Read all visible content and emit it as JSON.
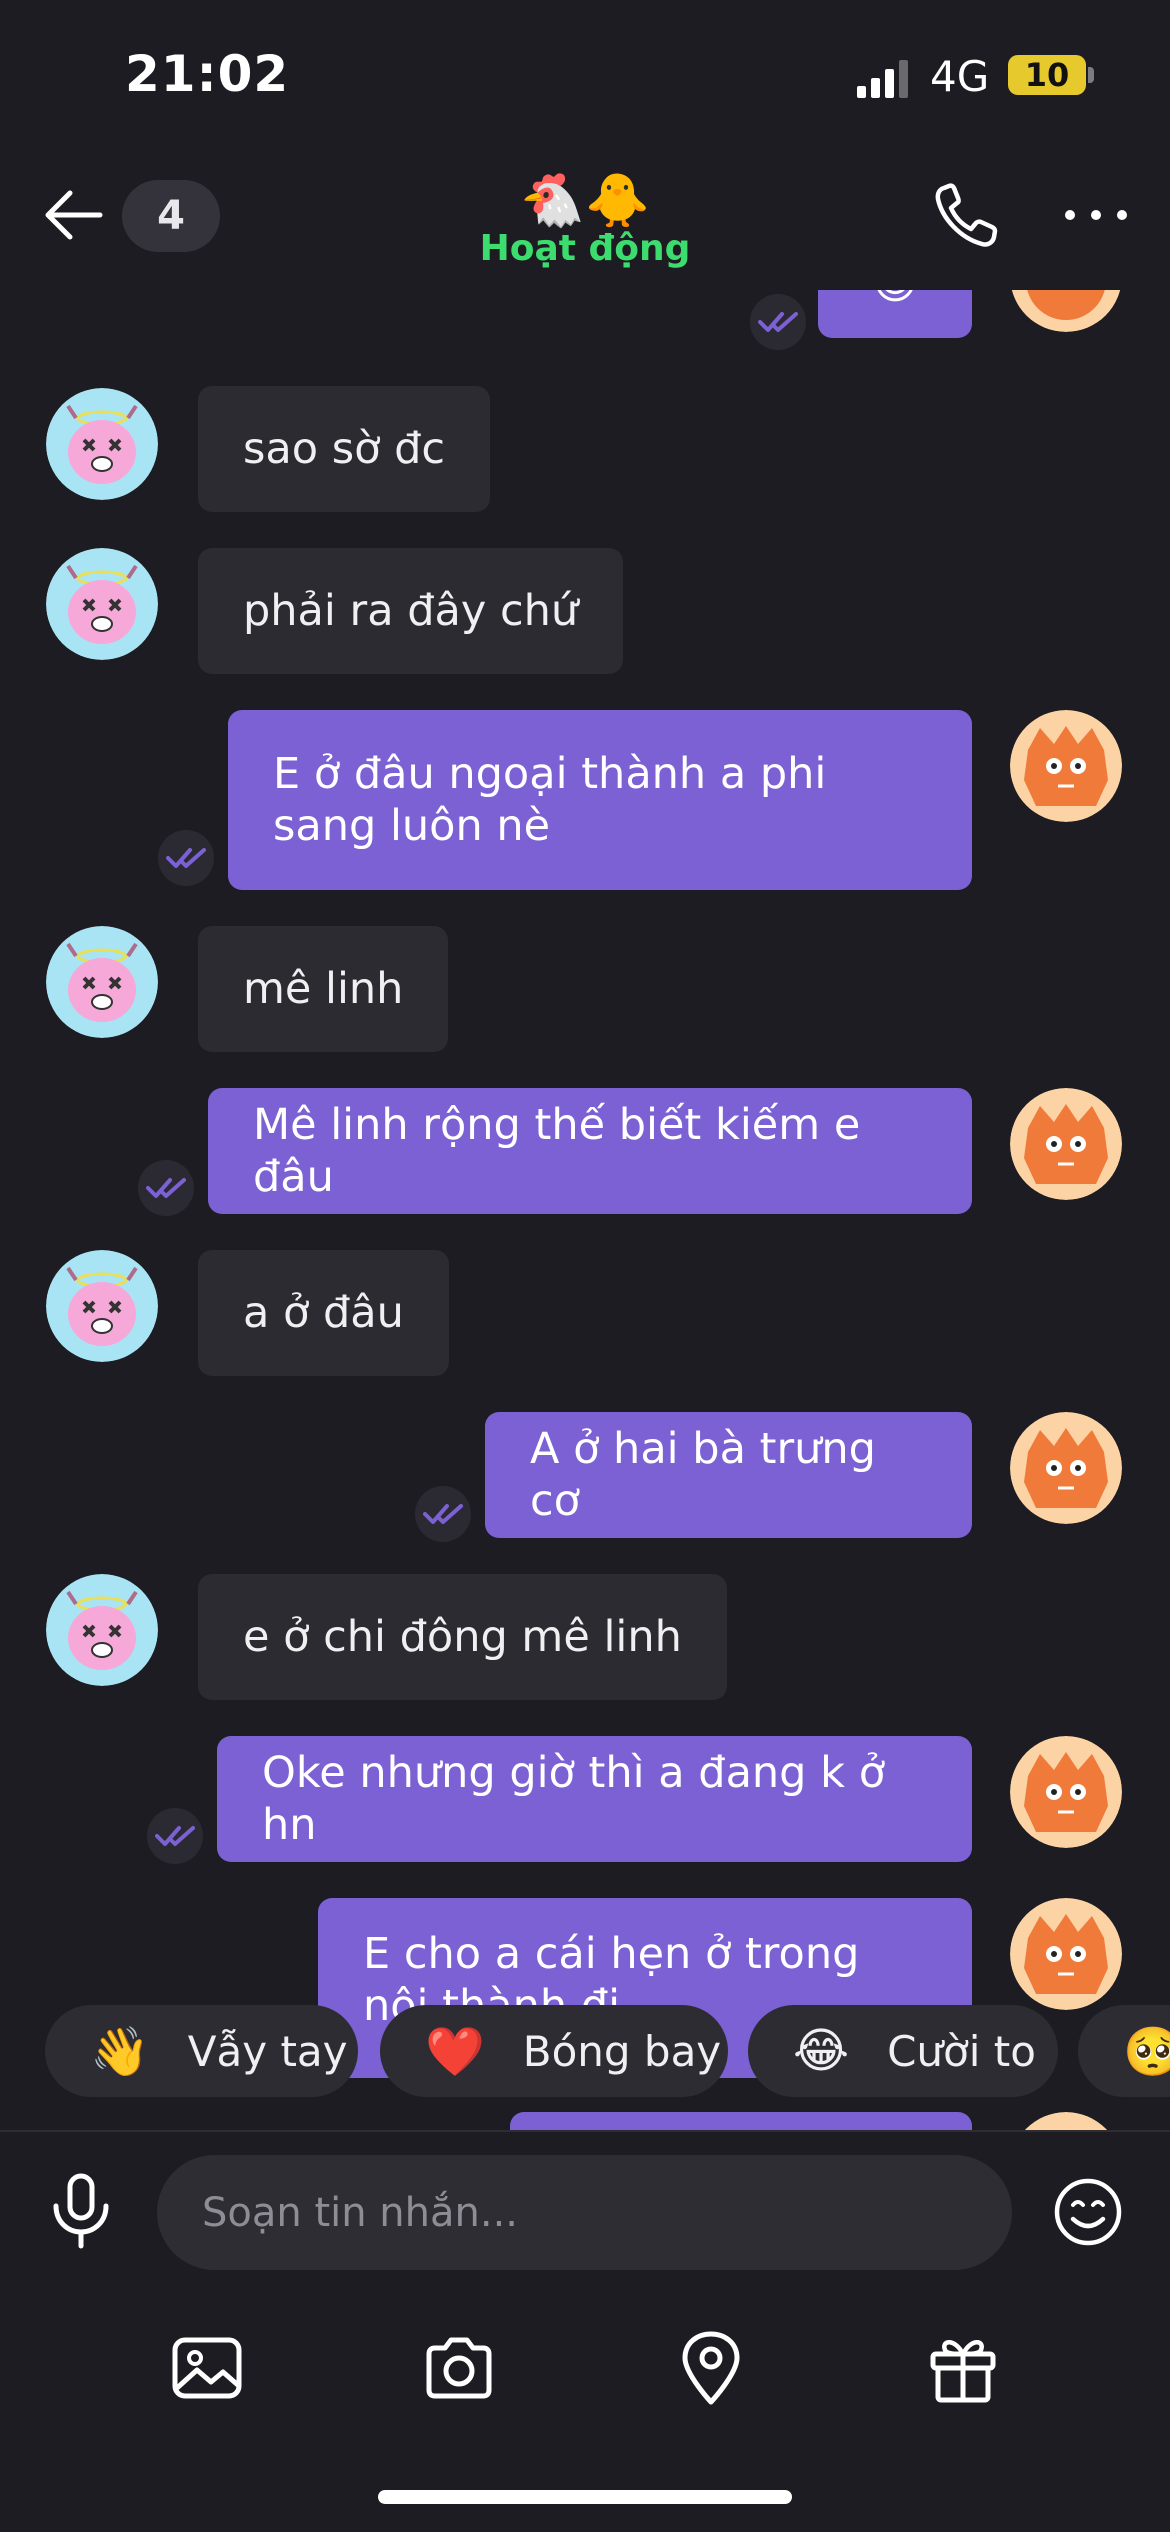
{
  "status_bar": {
    "time": "21:02",
    "network": "4G",
    "battery": "10"
  },
  "header": {
    "unread_count": "4",
    "emojis": "🐔🐥",
    "status": "Hoạt động"
  },
  "messages": [
    {
      "side": "in",
      "text": "sao sờ đc"
    },
    {
      "side": "in",
      "text": "phải ra đây chứ"
    },
    {
      "side": "out",
      "text": "E ở đâu ngoại thành a phi sang luôn nè"
    },
    {
      "side": "in",
      "text": "mê linh"
    },
    {
      "side": "out",
      "text": "Mê linh rộng thế biết kiếm e đâu"
    },
    {
      "side": "in",
      "text": "a ở đâu"
    },
    {
      "side": "out",
      "text": "A ở hai bà trưng cơ"
    },
    {
      "side": "in",
      "text": "e ở chi đông mê linh"
    },
    {
      "side": "out",
      "text": "Oke nhưng giờ thì a đang k ở hn"
    },
    {
      "side": "out",
      "text": "E cho a cái hẹn ở trong nội thành đi"
    }
  ],
  "quick_reactions": [
    {
      "emoji": "👋",
      "label": "Vẫy tay"
    },
    {
      "emoji": "❤️",
      "label": "Bóng bay"
    },
    {
      "emoji": "😂",
      "label": "Cười to"
    },
    {
      "emoji": "🥺",
      "label": ""
    }
  ],
  "composer": {
    "placeholder": "Soạn tin nhắn..."
  },
  "toolbar": [
    "image-icon",
    "camera-icon",
    "location-icon",
    "gift-icon"
  ],
  "colors": {
    "background": "#1d1c22",
    "incoming_bubble": "#2c2b31",
    "outgoing_bubble": "#7b61d3",
    "online_status": "#3ddc6e",
    "read_check": "#7b61d3"
  }
}
